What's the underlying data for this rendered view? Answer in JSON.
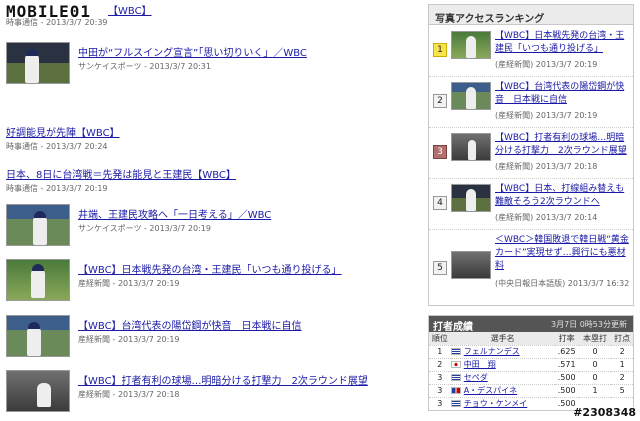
{
  "logo": {
    "text": "MOBILE01"
  },
  "top_article": {
    "title": "【WBC】",
    "meta": "時事通信 - 2013/3/7 20:39"
  },
  "articles": [
    {
      "title": "中田が“フルスイング宣言”「思い切りいく」／WBC",
      "meta": "サンケイスポーツ - 2013/3/7 20:31",
      "thumb": "player-photo"
    },
    {
      "title": "好調能見が先陣【WBC】",
      "meta": "時事通信 - 2013/3/7 20:24",
      "thumb": null
    },
    {
      "title": "日本、8日に台湾戦＝先発は能見と王建民【WBC】",
      "meta": "時事通信 - 2013/3/7 20:19",
      "thumb": null
    },
    {
      "title": "井端、王建民攻略へ「一日考える」／WBC",
      "meta": "サンケイスポーツ - 2013/3/7 20:19",
      "thumb": "player-photo"
    },
    {
      "title": "【WBC】日本戦先発の台湾・王建民「いつも通り投げる」",
      "meta": "産経新聞 - 2013/3/7 20:19",
      "thumb": "player-photo"
    },
    {
      "title": "【WBC】台湾代表の陽岱鋼が快音　日本戦に自信",
      "meta": "産経新聞 - 2013/3/7 20:19",
      "thumb": "player-photo"
    },
    {
      "title": "【WBC】打者有利の球場…明暗分ける打撃力　2次ラウンド展望",
      "meta": "産経新聞 - 2013/3/7 20:18",
      "thumb": "stadium-photo"
    }
  ],
  "ranking": {
    "heading": "写真アクセスランキング",
    "items": [
      {
        "rank": "1",
        "title": "【WBC】日本戦先発の台湾・王建民「いつも通り投げる」",
        "meta": "(産経新聞) 2013/3/7 20:19"
      },
      {
        "rank": "2",
        "title": "【WBC】台湾代表の陽岱鋼が快音　日本戦に自信",
        "meta": "(産経新聞) 2013/3/7 20:19"
      },
      {
        "rank": "3",
        "title": "【WBC】打者有利の球場…明暗分ける打撃力　2次ラウンド展望",
        "meta": "(産経新聞) 2013/3/7 20:18"
      },
      {
        "rank": "4",
        "title": "【WBC】日本、打線組み替えも難敵そろう2次ラウンドへ",
        "meta": "(産経新聞) 2013/3/7 20:14"
      },
      {
        "rank": "5",
        "title": "＜WBC＞韓国敗退で韓日戦“黄金カード”実現せず…興行にも悪材料",
        "meta": "(中央日報日本語版) 2013/3/7 16:32"
      }
    ]
  },
  "batting": {
    "heading": "打者成績",
    "date": "3月7日 0時53分更新",
    "columns": [
      "順位",
      "選手名",
      "打率",
      "本塁打",
      "打点"
    ],
    "rows": [
      {
        "rank": "1",
        "flag": "cuba",
        "name": "フェルナンデス",
        "avg": ".625",
        "hr": "0",
        "rbi": "2"
      },
      {
        "rank": "2",
        "flag": "japan",
        "name": "中田　翔",
        "avg": ".571",
        "hr": "0",
        "rbi": "1"
      },
      {
        "rank": "3",
        "flag": "cuba",
        "name": "セペダ",
        "avg": ".500",
        "hr": "0",
        "rbi": "2"
      },
      {
        "rank": "3",
        "flag": "dom",
        "name": "A・デスパイネ",
        "avg": ".500",
        "hr": "1",
        "rbi": "5"
      },
      {
        "rank": "3",
        "flag": "cuba",
        "name": "チョウ・ケンメイ",
        "avg": ".500",
        "hr": "",
        "rbi": ""
      }
    ]
  },
  "watermark": "#2308348"
}
